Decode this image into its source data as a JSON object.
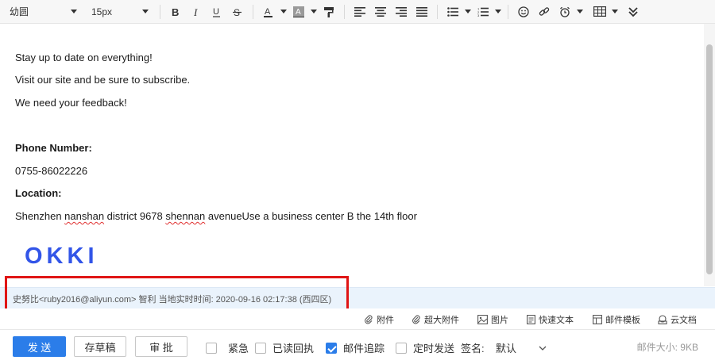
{
  "toolbar": {
    "font_family": "幼圆",
    "font_size": "15px",
    "icons": [
      "bold-icon",
      "italic-icon",
      "underline-icon",
      "strikethrough-icon",
      "font-color-icon",
      "highlight-icon",
      "format-painter-icon",
      "align-left-icon",
      "align-center-icon",
      "align-right-icon",
      "justify-icon",
      "bulleted-list-icon",
      "numbered-list-icon",
      "emoji-icon",
      "link-icon",
      "alarm-icon",
      "table-icon",
      "more-icon"
    ]
  },
  "body": {
    "line1": "Stay up to date on everything!",
    "line2": "Visit our site and be sure to subscribe.",
    "line3": "We need your feedback!",
    "phone_label": "Phone Number:",
    "phone_value": "0755-86022226",
    "location_label": "Location:",
    "location_pre": "Shenzhen ",
    "location_w1": "nanshan",
    "location_mid": " district 9678 ",
    "location_w2": "shennan",
    "location_post": " avenueUse a business center B the 14th floor",
    "logo_text": "OKKI",
    "logo_color": "#3255e8"
  },
  "signature": {
    "text": "史努比<ruby2016@aliyun.com> 智利 当地实时时间: 2020-09-16 02:17:38 (西四区)"
  },
  "attachments": {
    "attach": "附件",
    "large_attach": "超大附件",
    "image": "图片",
    "quick_text": "快速文本",
    "template": "邮件模板",
    "cloud_doc": "云文档"
  },
  "footer": {
    "send": "发 送",
    "save_draft": "存草稿",
    "approve": "审 批",
    "urgent": "紧急",
    "read_receipt": "已读回执",
    "tracking": "邮件追踪",
    "scheduled": "定时发送",
    "signature_label": "签名:",
    "signature_value": "默认",
    "mail_size": "邮件大小: 9KB"
  }
}
